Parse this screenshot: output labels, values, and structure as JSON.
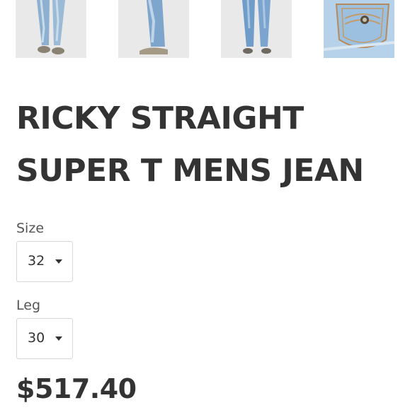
{
  "thumbnails": [
    {
      "icon": "jeans-front-photo"
    },
    {
      "icon": "jeans-side-photo"
    },
    {
      "icon": "jeans-back-photo"
    },
    {
      "icon": "jeans-pocket-detail-photo"
    }
  ],
  "product": {
    "title_line1": "RICKY STRAIGHT",
    "title_line2": "SUPER T MENS JEAN",
    "price": "$517.40"
  },
  "size": {
    "label": "Size",
    "value": "32"
  },
  "leg": {
    "label": "Leg",
    "value": "30"
  },
  "colors": {
    "text": "#333333",
    "border": "#d7d7d7",
    "denim": "#8fb3d4"
  }
}
